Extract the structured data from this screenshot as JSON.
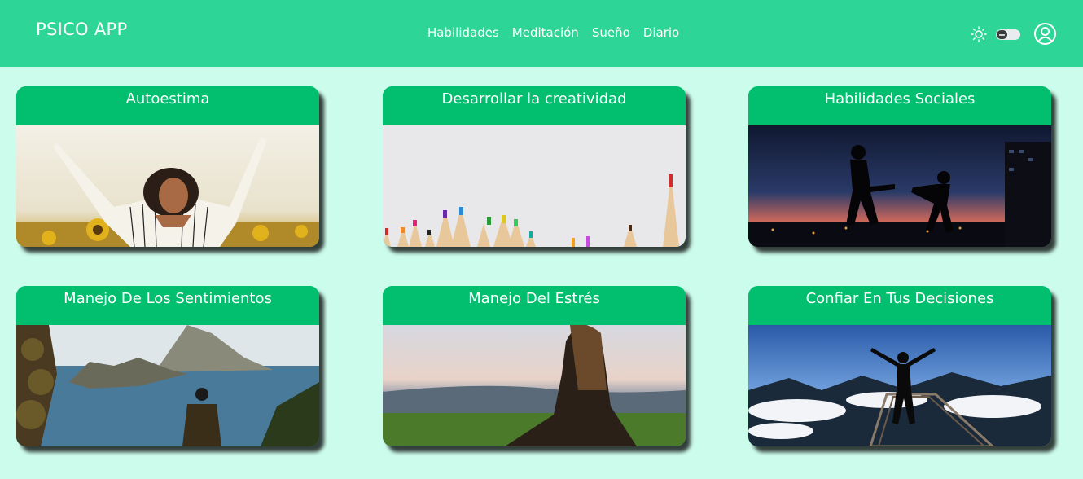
{
  "header": {
    "brand": "PSICO APP",
    "nav": [
      {
        "label": "Habilidades"
      },
      {
        "label": "Meditación"
      },
      {
        "label": "Sueño"
      },
      {
        "label": "Diario"
      }
    ],
    "theme_icon": "sun-icon",
    "theme_toggle_state": "off",
    "user_icon": "user-circle-icon"
  },
  "cards": [
    {
      "title": "Autoestima",
      "image": "woman-arms-raised-sunflowers"
    },
    {
      "title": "Desarrollar la creatividad",
      "image": "colored-pencils"
    },
    {
      "title": "Habilidades Sociales",
      "image": "couple-silhouette-dusk-city"
    },
    {
      "title": "Manejo De Los Sentimientos",
      "image": "man-sitting-by-sea-cliffs"
    },
    {
      "title": "Manejo Del Estrés",
      "image": "woman-sitting-meadow"
    },
    {
      "title": "Confiar En Tus Decisiones",
      "image": "person-arms-open-above-clouds"
    }
  ],
  "colors": {
    "background": "#ccfcec",
    "navbar": "#2dd596",
    "card_header": "#01bf6e",
    "text": "#ffffff"
  }
}
